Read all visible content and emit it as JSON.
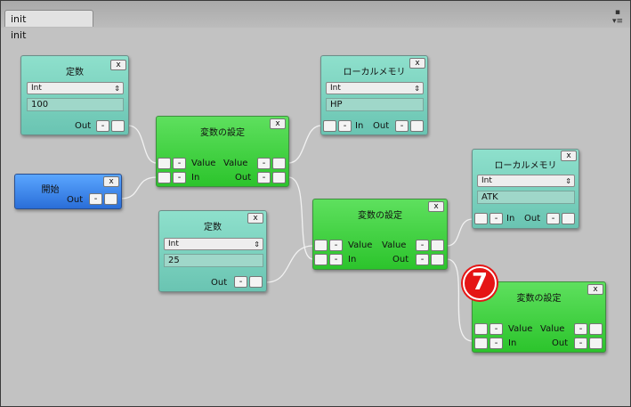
{
  "window": {
    "tab_title": "init",
    "canvas_label": "init",
    "menu_icon": "menu-icon",
    "pin_icon": "pin-icon"
  },
  "nodes": {
    "const1": {
      "title": "定数",
      "close": "x",
      "type": "Int",
      "value": "100",
      "port_out": "Out",
      "minus": "-"
    },
    "local1": {
      "title": "ローカルメモリ",
      "close": "x",
      "type": "Int",
      "value": "HP",
      "port_in": "In",
      "port_out": "Out",
      "minus": "-"
    },
    "setvar1": {
      "title": "変数の設定",
      "close": "x",
      "value_in": "Value",
      "value_out": "Value",
      "port_in": "In",
      "port_out": "Out",
      "minus": "-"
    },
    "start": {
      "title": "開始",
      "close": "x",
      "port_out": "Out",
      "minus": "-"
    },
    "const2": {
      "title": "定数",
      "close": "x",
      "type": "Int",
      "value": "25",
      "port_out": "Out",
      "minus": "-"
    },
    "setvar2": {
      "title": "変数の設定",
      "close": "x",
      "value_in": "Value",
      "value_out": "Value",
      "port_in": "In",
      "port_out": "Out",
      "minus": "-"
    },
    "local2": {
      "title": "ローカルメモリ",
      "close": "x",
      "type": "Int",
      "value": "ATK",
      "port_in": "In",
      "port_out": "Out",
      "minus": "-"
    },
    "setvar3": {
      "title": "変数の設定",
      "close": "x",
      "value_in": "Value",
      "value_out": "Value",
      "port_in": "In",
      "port_out": "Out",
      "minus": "-"
    }
  },
  "annotation": {
    "badge": "7"
  },
  "colors": {
    "teal_node": "#7ad2bf",
    "green_node": "#3ed03e",
    "blue_node": "#3f86ec",
    "canvas": "#c2c2c2",
    "badge": "#e51515"
  }
}
